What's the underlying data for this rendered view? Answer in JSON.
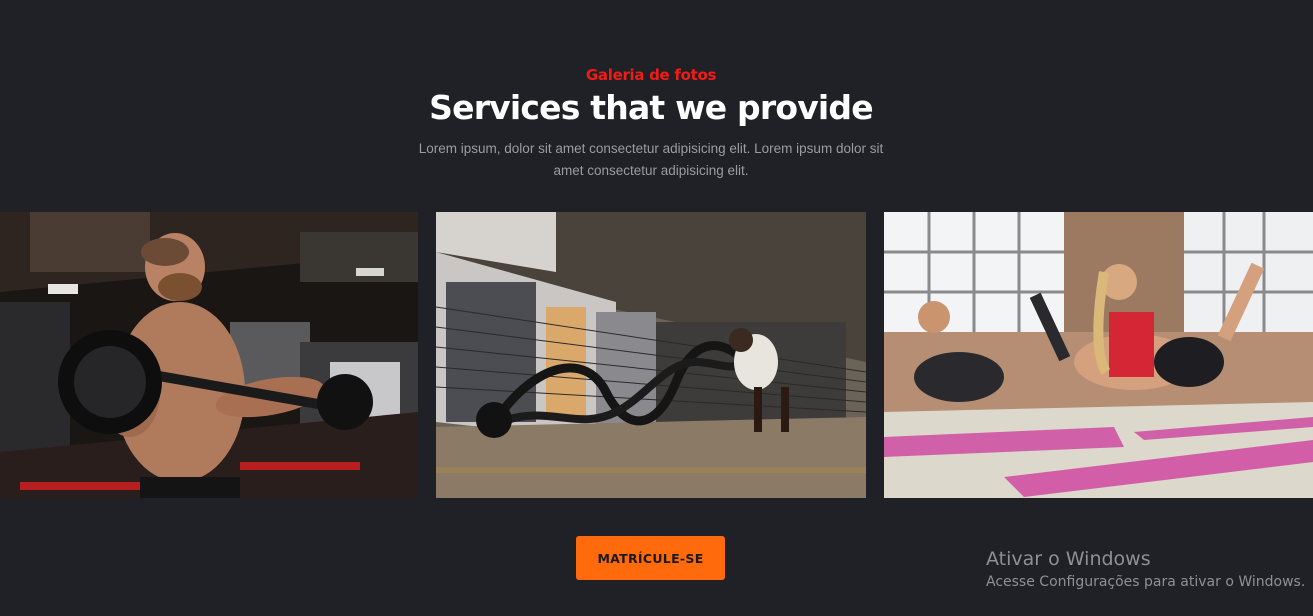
{
  "header": {
    "eyebrow": "Galeria de fotos",
    "title": "Services that we provide",
    "subtitle": "Lorem ipsum, dolor sit amet consectetur adipisicing elit. Lorem ipsum dolor sit amet consectetur adipisicing elit."
  },
  "gallery": {
    "photos": [
      {
        "subject": "man lifting barbell in gym"
      },
      {
        "subject": "man training with battle ropes"
      },
      {
        "subject": "women exercising on pink yoga mats"
      }
    ]
  },
  "cta": {
    "label": "MATRÍCULE-SE"
  },
  "colors": {
    "background": "#1f2126",
    "accent_red": "#f21c14",
    "button_orange": "#ff6a0c"
  },
  "windows_watermark": {
    "line1": "Ativar o Windows",
    "line2": "Acesse Configurações para ativar o Windows."
  }
}
